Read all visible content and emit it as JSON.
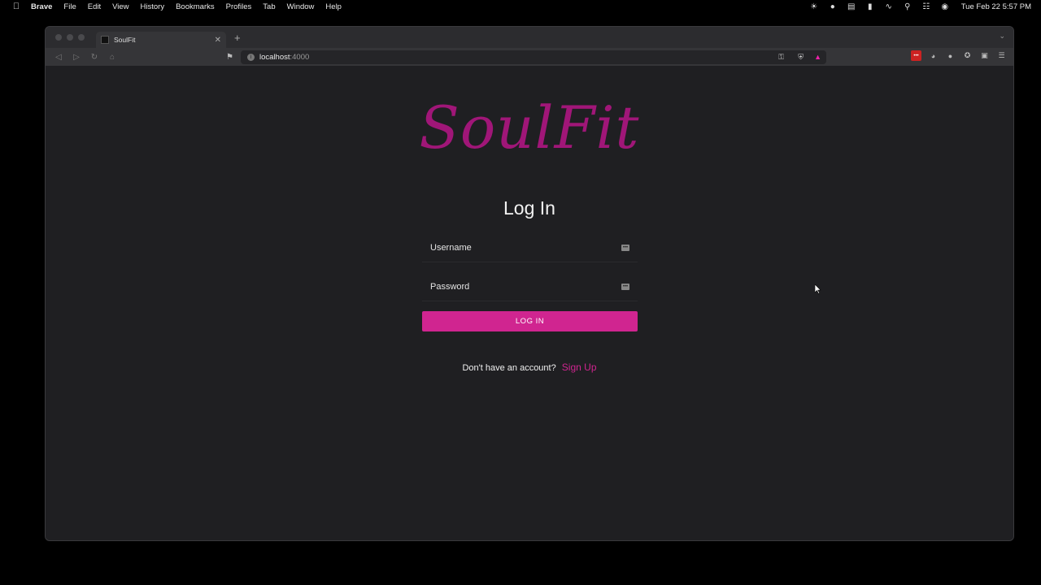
{
  "menubar": {
    "app": "Brave",
    "items": [
      "File",
      "Edit",
      "View",
      "History",
      "Bookmarks",
      "Profiles",
      "Tab",
      "Window",
      "Help"
    ],
    "clock": "Tue Feb 22  5:57 PM"
  },
  "browser": {
    "tab_title": "SoulFit",
    "url_host": "localhost",
    "url_port": ":4000"
  },
  "page": {
    "logo": "SoulFit",
    "heading": "Log In",
    "username_placeholder": "Username",
    "password_placeholder": "Password",
    "login_button": "LOG IN",
    "signup_prompt": "Don't have an account?",
    "signup_link": "Sign Up"
  },
  "colors": {
    "accent": "#d02590",
    "logo": "#a01678",
    "background": "#1f1f22"
  }
}
